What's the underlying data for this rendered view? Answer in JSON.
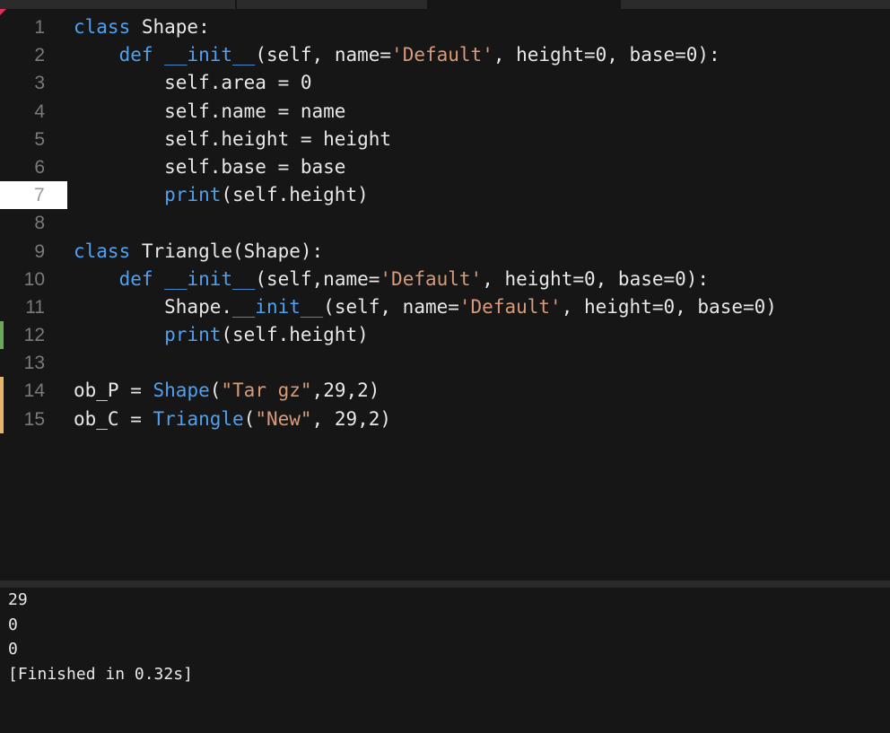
{
  "editor": {
    "lines": [
      {
        "number": "1",
        "tokens": [
          {
            "t": "class",
            "c": "kw"
          },
          {
            "t": " Shape:",
            "c": "plain"
          }
        ]
      },
      {
        "number": "2",
        "tokens": [
          {
            "t": "    ",
            "c": "plain"
          },
          {
            "t": "def",
            "c": "kw"
          },
          {
            "t": " ",
            "c": "plain"
          },
          {
            "t": "__init__",
            "c": "kw"
          },
          {
            "t": "(self, name=",
            "c": "plain"
          },
          {
            "t": "'Default'",
            "c": "str"
          },
          {
            "t": ", height=0, base=0):",
            "c": "plain"
          }
        ]
      },
      {
        "number": "3",
        "tokens": [
          {
            "t": "        self.area = 0",
            "c": "plain"
          }
        ]
      },
      {
        "number": "4",
        "tokens": [
          {
            "t": "        self.name = name",
            "c": "plain"
          }
        ]
      },
      {
        "number": "5",
        "tokens": [
          {
            "t": "        self.height = height",
            "c": "plain"
          }
        ]
      },
      {
        "number": "6",
        "tokens": [
          {
            "t": "        self.base = base",
            "c": "plain"
          }
        ]
      },
      {
        "number": "7",
        "current": true,
        "tokens": [
          {
            "t": "        ",
            "c": "plain"
          },
          {
            "t": "print",
            "c": "kw"
          },
          {
            "t": "(self.height)",
            "c": "plain"
          }
        ]
      },
      {
        "number": "8",
        "tokens": []
      },
      {
        "number": "9",
        "tokens": [
          {
            "t": "class",
            "c": "kw"
          },
          {
            "t": " Triangle(Shape):",
            "c": "plain"
          }
        ]
      },
      {
        "number": "10",
        "tokens": [
          {
            "t": "    ",
            "c": "plain"
          },
          {
            "t": "def",
            "c": "kw"
          },
          {
            "t": " ",
            "c": "plain"
          },
          {
            "t": "__init__",
            "c": "kw"
          },
          {
            "t": "(self,name=",
            "c": "plain"
          },
          {
            "t": "'Default'",
            "c": "str"
          },
          {
            "t": ", height=0, base=0):",
            "c": "plain"
          }
        ]
      },
      {
        "number": "11",
        "tokens": [
          {
            "t": "        Shape.",
            "c": "plain"
          },
          {
            "t": "__init__",
            "c": "kw"
          },
          {
            "t": "(self, name=",
            "c": "plain"
          },
          {
            "t": "'Default'",
            "c": "str"
          },
          {
            "t": ", height=0, base=0)",
            "c": "plain"
          }
        ]
      },
      {
        "number": "12",
        "marker": "added",
        "tokens": [
          {
            "t": "        ",
            "c": "plain"
          },
          {
            "t": "print",
            "c": "kw"
          },
          {
            "t": "(self.height)",
            "c": "plain"
          }
        ]
      },
      {
        "number": "13",
        "tokens": []
      },
      {
        "number": "14",
        "marker": "modified",
        "tokens": [
          {
            "t": "ob_P = ",
            "c": "plain"
          },
          {
            "t": "Shape",
            "c": "kw"
          },
          {
            "t": "(",
            "c": "plain"
          },
          {
            "t": "\"Tar gz\"",
            "c": "str"
          },
          {
            "t": ",29,2)",
            "c": "plain"
          }
        ]
      },
      {
        "number": "15",
        "marker": "modified",
        "tokens": [
          {
            "t": "ob_C = ",
            "c": "plain"
          },
          {
            "t": "Triangle",
            "c": "kw"
          },
          {
            "t": "(",
            "c": "plain"
          },
          {
            "t": "\"New\"",
            "c": "str"
          },
          {
            "t": ", 29,2)",
            "c": "plain"
          }
        ]
      }
    ]
  },
  "output": {
    "lines": [
      "29",
      "0",
      "0",
      "[Finished in 0.32s]"
    ]
  },
  "colors": {
    "keyword": "#4fa0f0",
    "string": "#d89a78",
    "text": "#e8e8e8",
    "background": "#161616",
    "added_marker": "#6aa85d",
    "modified_marker": "#e8b36a"
  }
}
